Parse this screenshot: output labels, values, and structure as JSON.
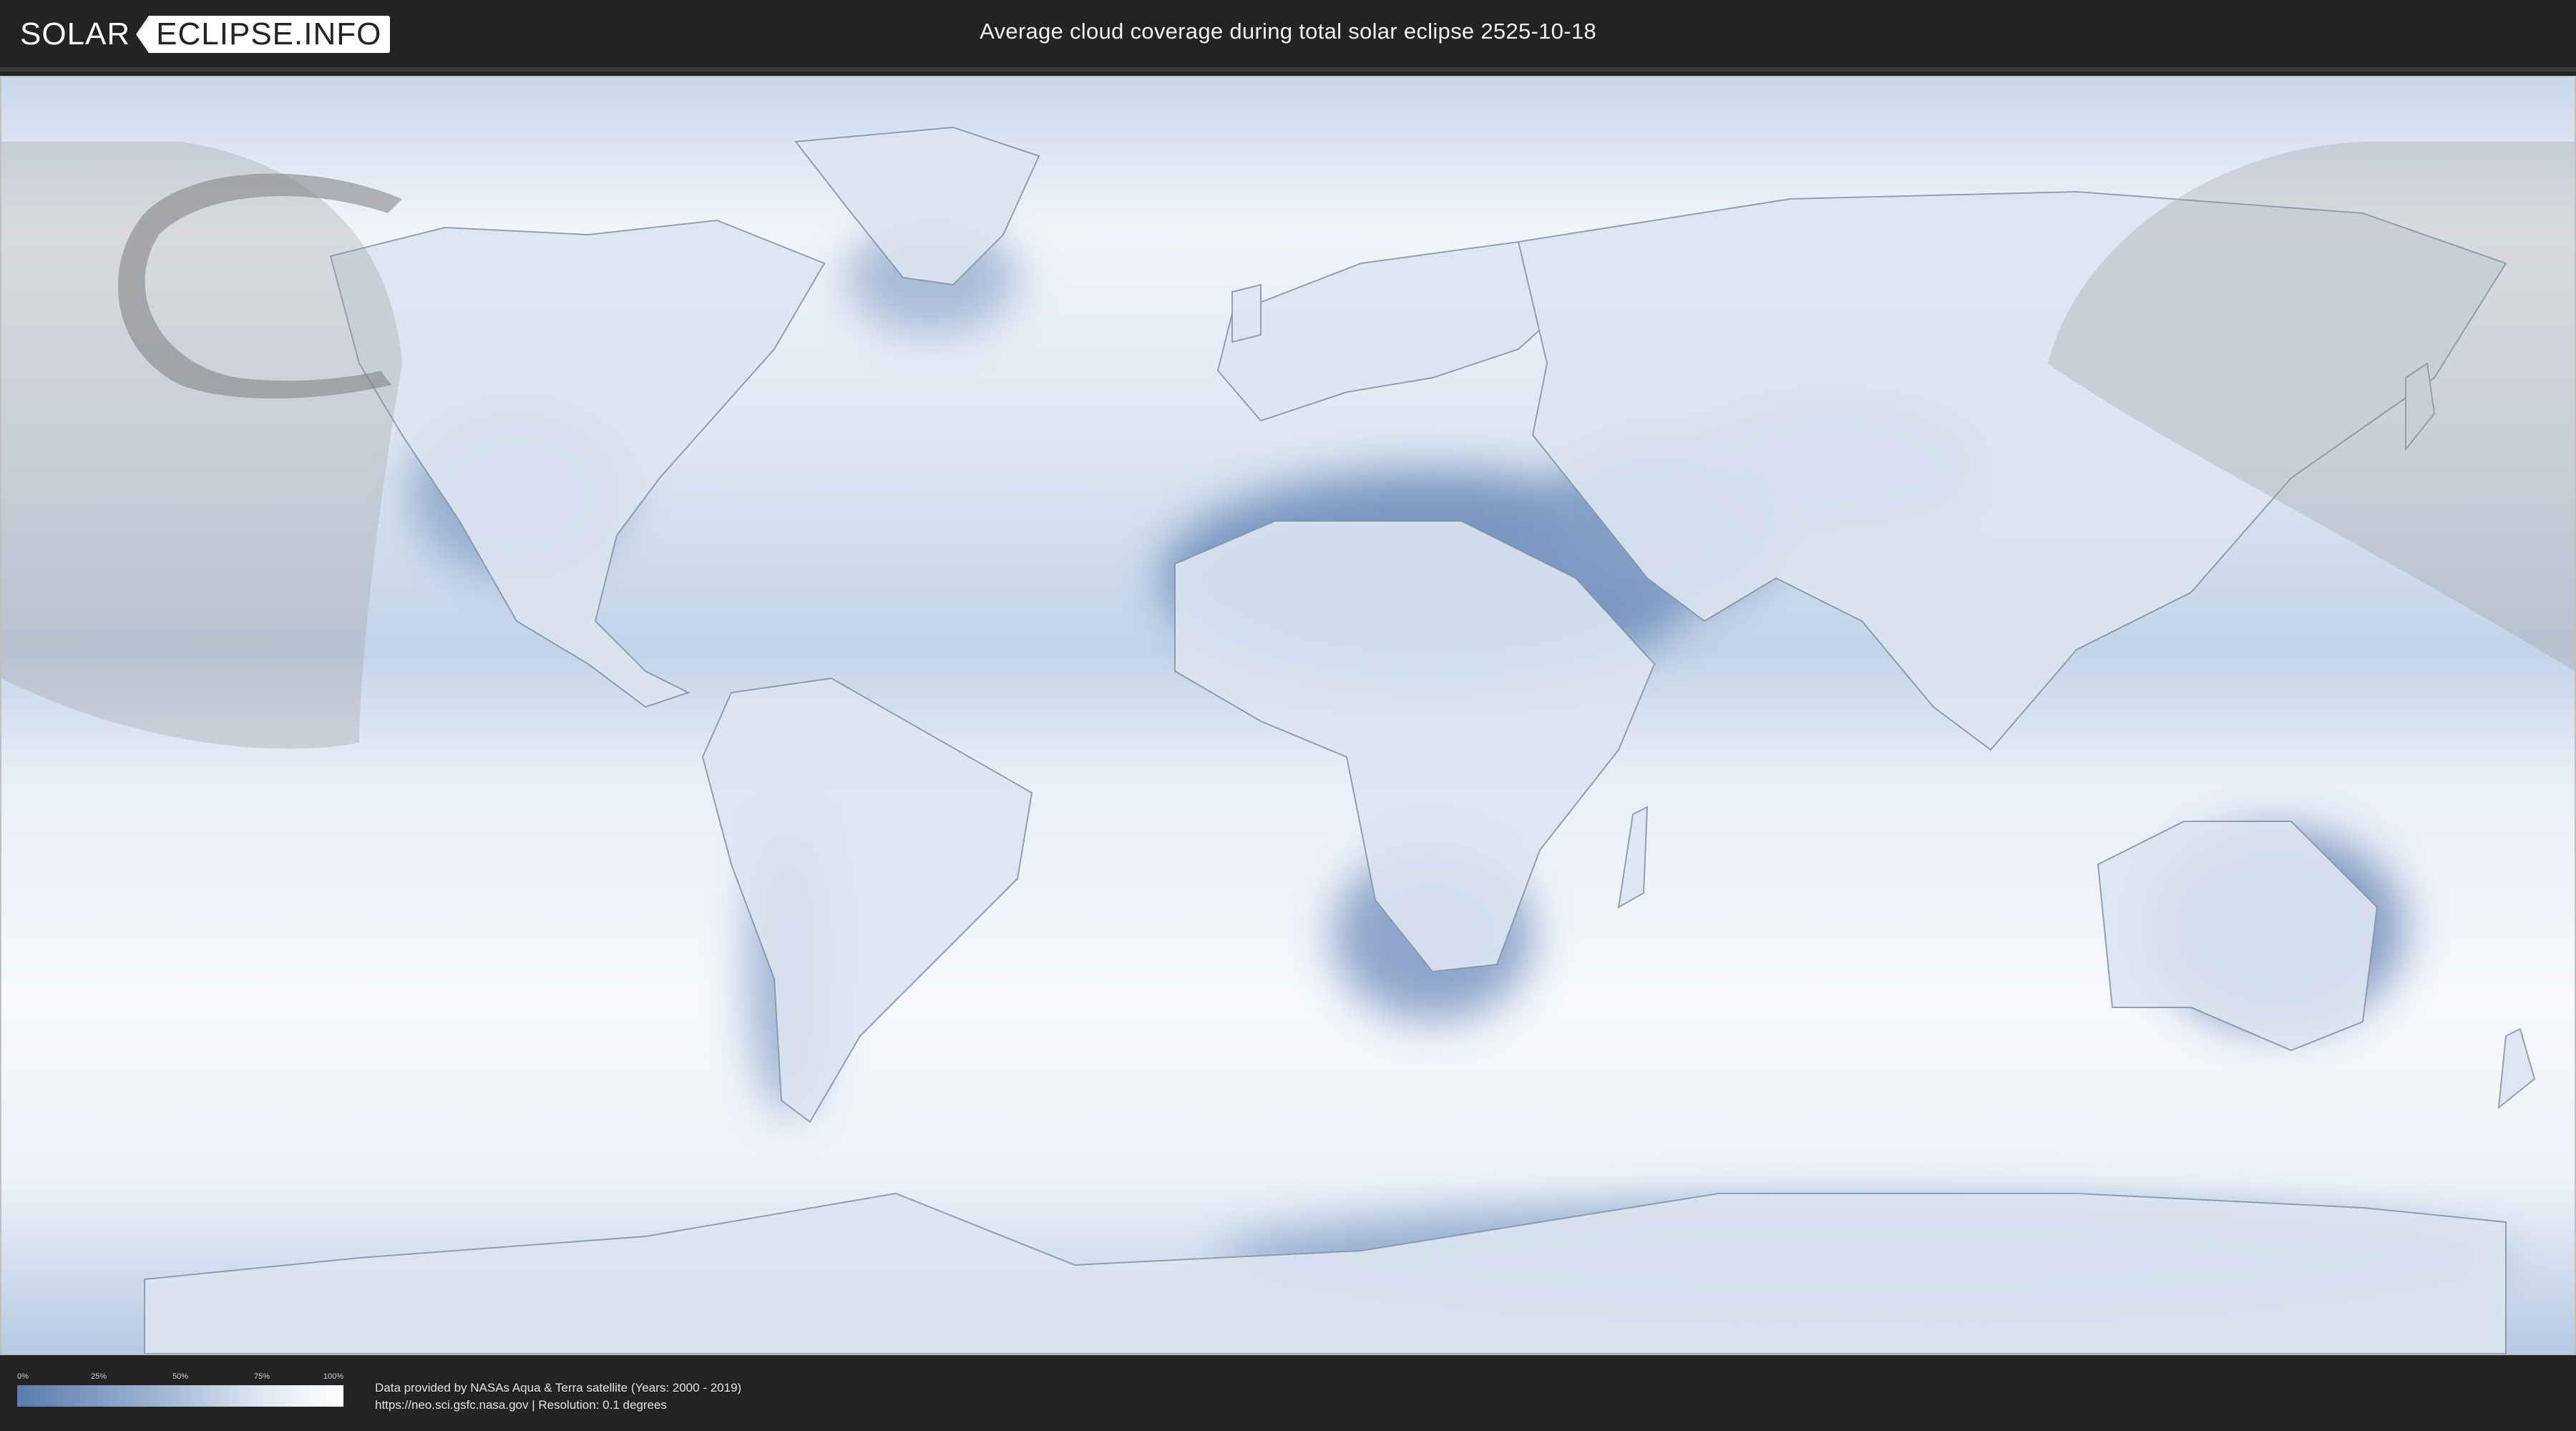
{
  "header": {
    "logo_solar": "SOLAR",
    "logo_eclipse": "ECLIPSE.INFO",
    "title": "Average cloud coverage during total solar eclipse 2525-10-18"
  },
  "map": {
    "colors": {
      "clear": "#5b7bab",
      "cloudy": "#ffffff",
      "mid": "#a6bad6",
      "land_outline": "#8a97a8",
      "eclipse_shade": "#9a9a9a",
      "path_band": "#7d7d7d"
    }
  },
  "legend": {
    "ticks": [
      "0%",
      "25%",
      "50%",
      "75%",
      "100%"
    ]
  },
  "credits": {
    "line1": "Data provided by NASAs Aqua & Terra satellite (Years: 2000 - 2019)",
    "line2": "https://neo.sci.gsfc.nasa.gov | Resolution: 0.1 degrees"
  }
}
